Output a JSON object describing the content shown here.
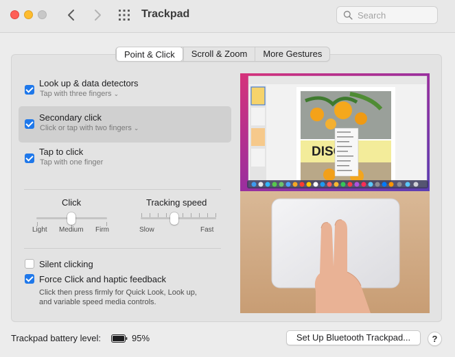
{
  "window": {
    "title": "Trackpad",
    "search_placeholder": "Search"
  },
  "tabs": [
    {
      "label": "Point & Click",
      "active": true
    },
    {
      "label": "Scroll & Zoom",
      "active": false
    },
    {
      "label": "More Gestures",
      "active": false
    }
  ],
  "options": {
    "lookup": {
      "title": "Look up & data detectors",
      "subtitle": "Tap with three fingers",
      "checked": true
    },
    "secondary": {
      "title": "Secondary click",
      "subtitle": "Click or tap with two fingers",
      "checked": true
    },
    "tap": {
      "title": "Tap to click",
      "subtitle": "Tap with one finger",
      "checked": true
    }
  },
  "click_slider": {
    "label": "Click",
    "ticks": [
      "Light",
      "Medium",
      "Firm"
    ],
    "value": "Medium"
  },
  "tracking_slider": {
    "label": "Tracking speed",
    "min_label": "Slow",
    "max_label": "Fast",
    "value_fraction": 0.4
  },
  "silent": {
    "label": "Silent clicking",
    "checked": false
  },
  "force": {
    "label": "Force Click and haptic feedback",
    "checked": true,
    "desc1": "Click then press firmly for Quick Look, Look up,",
    "desc2": "and variable speed media controls."
  },
  "preview_screen": {
    "headline": "DISCT"
  },
  "footer": {
    "battery_label": "Trackpad battery level:",
    "battery_value": "95%",
    "setup_label": "Set Up Bluetooth Trackpad...",
    "help_label": "?"
  },
  "colors": {
    "accent": "#1f78ea",
    "close": "#fe5f57",
    "minimize": "#febc2e"
  }
}
